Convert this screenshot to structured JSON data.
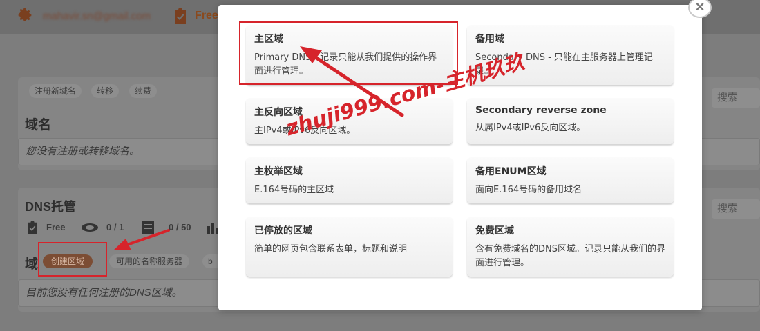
{
  "header": {
    "email": "mahavir.sn@gmail.com",
    "plan_label": "Free"
  },
  "domains_section": {
    "actions": [
      "注册新域名",
      "转移",
      "续费"
    ],
    "title": "域名",
    "search_placeholder": "搜索",
    "empty_message": "您没有注册或转移域名。"
  },
  "dns_section": {
    "title": "DNS托管",
    "stats": [
      {
        "icon": "badge-icon",
        "value": "Free"
      },
      {
        "icon": "network-icon",
        "value": "0 / 1"
      },
      {
        "icon": "records-icon",
        "value": "0 / 50"
      }
    ],
    "zones_heading": "域",
    "create_zone_label": "创建区域",
    "available_ns_label": "可用的名称服务器",
    "extra_tab": "b",
    "search_placeholder": "搜索",
    "empty_message": "目前您没有任何注册的DNS区域。"
  },
  "modal": {
    "close_symbol": "×",
    "zone_types": [
      {
        "title": "主区域",
        "description": "Primary DNS - 记录只能从我们提供的操作界面进行管理。"
      },
      {
        "title": "备用域",
        "description": "Secondary DNS - 只能在主服务器上管理记录。"
      },
      {
        "title": "主反向区域",
        "description": "主IPv4或IPv6反向区域。"
      },
      {
        "title": "Secondary reverse zone",
        "description": "从属IPv4或IPv6反向区域。"
      },
      {
        "title": "主枚举区域",
        "description": "E.164号码的主区域"
      },
      {
        "title": "备用ENUM区域",
        "description": "面向E.164号码的备用域名"
      },
      {
        "title": "已停放的区域",
        "description": "简单的网页包含联系表单，标题和说明"
      },
      {
        "title": "免费区域",
        "description": "含有免费域名的DNS区域。记录只能从我们的界面进行管理。"
      }
    ]
  },
  "watermark": "zhuji999.com-主机玖玖",
  "colors": {
    "accent": "#d6242b",
    "brand_brown": "#8a4a1e",
    "overlay": "#7d7d7d"
  }
}
